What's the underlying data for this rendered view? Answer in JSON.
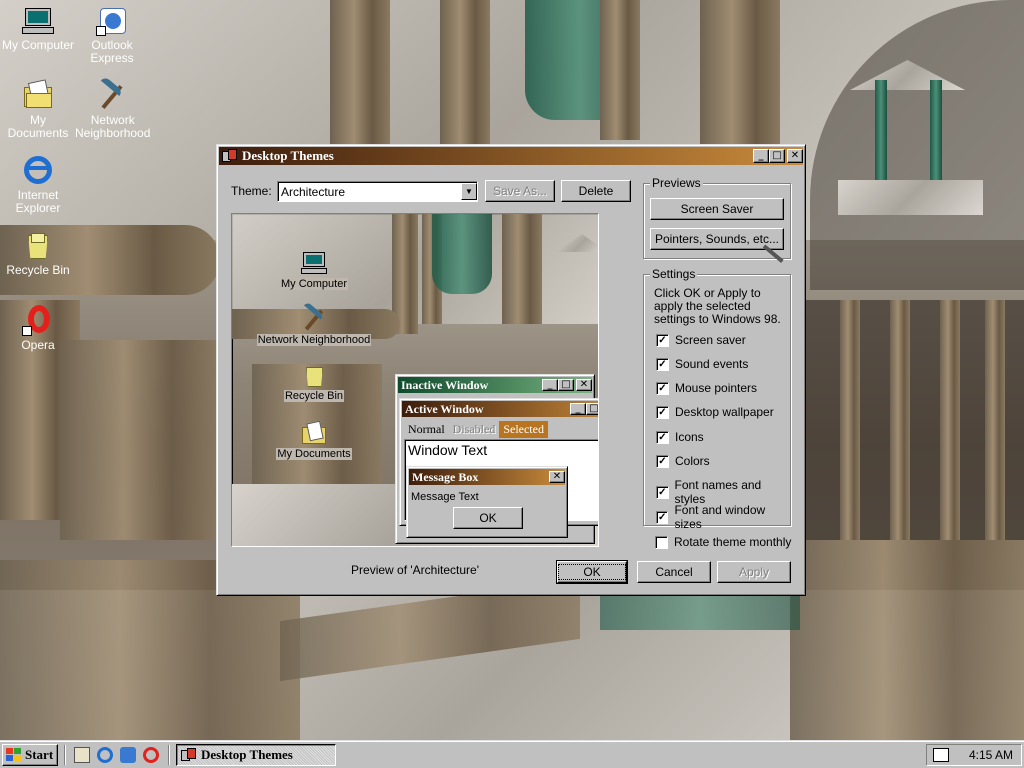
{
  "desktop": {
    "icons": [
      {
        "label": "My Computer"
      },
      {
        "label": "Outlook Express"
      },
      {
        "label": "My Documents"
      },
      {
        "label": "Network Neighborhood"
      },
      {
        "label": "Internet Explorer"
      },
      {
        "label": "Recycle Bin"
      },
      {
        "label": "Opera"
      }
    ]
  },
  "dialog": {
    "title": "Desktop Themes",
    "theme_label": "Theme:",
    "theme_value": "Architecture",
    "save_as": "Save As...",
    "delete": "Delete",
    "preview_caption": "Preview of 'Architecture'",
    "previews_group": "Previews",
    "screen_saver": "Screen Saver",
    "pointers_sounds": "Pointers, Sounds, etc...",
    "settings_group": "Settings",
    "settings_text": "Click OK or Apply to apply the selected settings to Windows 98.",
    "settings": [
      {
        "label": "Screen saver",
        "checked": true
      },
      {
        "label": "Sound events",
        "checked": true
      },
      {
        "label": "Mouse pointers",
        "checked": true
      },
      {
        "label": "Desktop wallpaper",
        "checked": true
      },
      {
        "label": "Icons",
        "checked": true
      },
      {
        "label": "Colors",
        "checked": true
      },
      {
        "label": "Font names and styles",
        "checked": true
      },
      {
        "label": "Font and window sizes",
        "checked": true
      }
    ],
    "rotate_label": "Rotate theme monthly",
    "rotate_checked": false,
    "ok": "OK",
    "cancel": "Cancel",
    "apply": "Apply"
  },
  "preview": {
    "icons": [
      {
        "label": "My Computer"
      },
      {
        "label": "Network Neighborhood"
      },
      {
        "label": "Recycle Bin"
      },
      {
        "label": "My Documents"
      }
    ],
    "inactive_title": "Inactive Window",
    "active_title": "Active Window",
    "menu_normal": "Normal",
    "menu_disabled": "Disabled",
    "menu_selected": "Selected",
    "window_text": "Window Text",
    "msgbox_title": "Message Box",
    "msgbox_text": "Message Text",
    "msgbox_ok": "OK"
  },
  "taskbar": {
    "start": "Start",
    "task": "Desktop Themes",
    "clock": "4:15 AM"
  },
  "colors": {
    "title_active_start": "#3c1d0c",
    "title_active_end": "#c98b3c",
    "title_inactive_start": "#0f4a2c",
    "title_inactive_end": "#7ab482",
    "selection": "#b8741f"
  }
}
